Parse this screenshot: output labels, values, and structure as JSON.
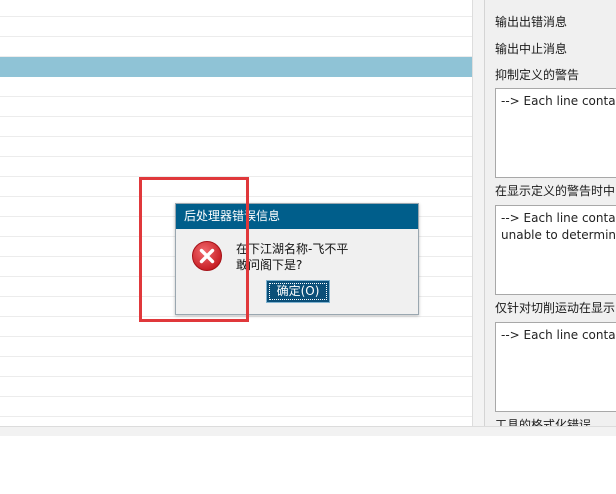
{
  "right_panel": {
    "labels": [
      "输出出错消息",
      "输出中止消息",
      "抑制定义的警告",
      "在显示定义的警告时中",
      "仅针对切削运动在显示"
    ],
    "boxes": [
      {
        "lines": [
          "--> Each line contain"
        ]
      },
      {
        "lines": [
          "--> Each line contain",
          "unable to determine"
        ]
      },
      {
        "lines": [
          "--> Each line contain"
        ]
      }
    ],
    "bottom_label": "工具的格式化错误"
  },
  "dialog": {
    "title": "后处理器错误信息",
    "message_line1": "在下江湖名称-飞不平",
    "message_line2": "敢问阁下是?",
    "ok_label": "确定(O)",
    "icon": "error-icon",
    "colors": {
      "title_bar": "#005e8b",
      "button": "#0b4f78",
      "error_red": "#d9262d"
    }
  },
  "list": {
    "selected_row_color": "#8fc3d6"
  },
  "annotation": {
    "color": "#e0383b"
  }
}
